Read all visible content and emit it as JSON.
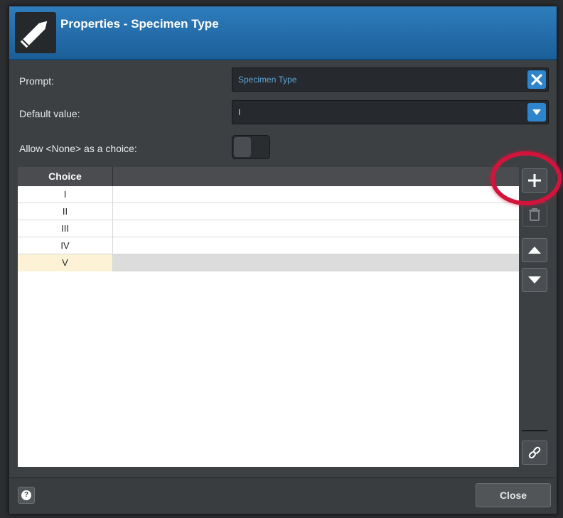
{
  "dialog": {
    "title": "Properties - Specimen Type",
    "title_icon": "pencil-icon"
  },
  "form": {
    "prompt_label": "Prompt:",
    "prompt_value": "Specimen Type",
    "prompt_clear_icon": "close-icon",
    "default_label": "Default value:",
    "default_value": "I",
    "default_dropdown_icon": "chevron-down-icon",
    "allow_none_label": "Allow <None> as a choice:",
    "allow_none_enabled": false
  },
  "grid": {
    "column_header": "Choice",
    "rows": [
      "I",
      "II",
      "III",
      "IV",
      "V"
    ],
    "selected_row": "V"
  },
  "side_toolbar": {
    "add_icon": "plus-icon",
    "delete_icon": "trash-icon",
    "move_up_icon": "triangle-up-icon",
    "move_down_icon": "triangle-down-icon",
    "link_icon": "link-icon"
  },
  "footer": {
    "help_icon": "help-icon",
    "help_glyph": "?",
    "close_label": "Close"
  },
  "colors": {
    "title_bar": "#1f6aa8",
    "accent": "#2e85cc",
    "annotation": "#d2143c",
    "selected_row": "#fdf2d6"
  }
}
